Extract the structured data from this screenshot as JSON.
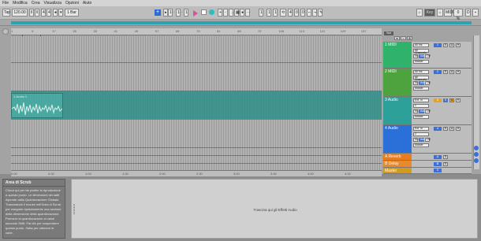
{
  "menu": [
    "File",
    "Modifica",
    "Crea",
    "Visualizza",
    "Opzioni",
    "Aiuto"
  ],
  "control": {
    "tap": "Tap",
    "tempo": "120.00",
    "sig_num": "4",
    "sig_den": "4",
    "quantize": "1 Bar",
    "position": [
      "1",
      ".",
      "1",
      ".",
      "1"
    ],
    "loop_start": [
      "1",
      ".",
      "1",
      ".",
      "1"
    ],
    "loop_length": [
      "4",
      ".",
      "0",
      ".",
      "0"
    ],
    "key": "Key",
    "midi": "MIDI",
    "cpu": "0 %",
    "d": "D"
  },
  "ruler_ticks": [
    "1",
    "9",
    "17",
    "25",
    "33",
    "41",
    "49",
    "57",
    "65",
    "73",
    "81",
    "89",
    "97",
    "105",
    "113",
    "121",
    "129",
    "137"
  ],
  "time_ticks": [
    "0:00",
    "0:30",
    "1:00",
    "1:30",
    "2:00",
    "2:30",
    "3:00",
    "3:30",
    "4:00",
    "4:30"
  ],
  "set_label": "Set",
  "tracks": [
    {
      "name": "1 MIDI",
      "color": "#2fb36a",
      "in": "All Ins",
      "ch": "All Channels",
      "mon": [
        "In",
        "Auto",
        "Off"
      ],
      "out": "Master",
      "num": "1"
    },
    {
      "name": "2 MIDI",
      "color": "#4fa33e",
      "in": "All Ins",
      "ch": "All Channels",
      "mon": [
        "In",
        "Auto",
        "Off"
      ],
      "out": "Master",
      "num": "2"
    },
    {
      "name": "3 Audio",
      "color": "#2ea09a",
      "in": "Ext. In",
      "ch": "1",
      "mon": [
        "In",
        "Auto",
        "Off"
      ],
      "out": "Master",
      "num": "3"
    },
    {
      "name": "4 Audio",
      "color": "#2b6fd9",
      "in": "Ext. In",
      "ch": "2",
      "mon": [
        "In",
        "Auto",
        "Off"
      ],
      "out": "Master",
      "num": "4"
    },
    {
      "name": "A Reverb",
      "color": "#e87c1e",
      "num": "A"
    },
    {
      "name": "B Delay",
      "color": "#e88a2a",
      "num": "B"
    },
    {
      "name": "Master",
      "color": "#d49a1c",
      "num": "0"
    }
  ],
  "clip": {
    "title": "1-Audio 1"
  },
  "info": {
    "title": "Area di Scrub",
    "text": "Clicca qui per far partire la riproduzione a questo punto. Le dimensioni dei salti dipende dalla Quantizzazione Globale. Trascinando il mouse nell'Area di Scrub per eseguire ripetutamente una sezione della dimensione della quantizzazione. Premere la quantizzazione ai valori secondo Shift. Fai clic per sospendere questo punto. Salta per ottenere le varie."
  },
  "detail": {
    "drop_msg": "Trascina qui gli Effetti Audio"
  }
}
